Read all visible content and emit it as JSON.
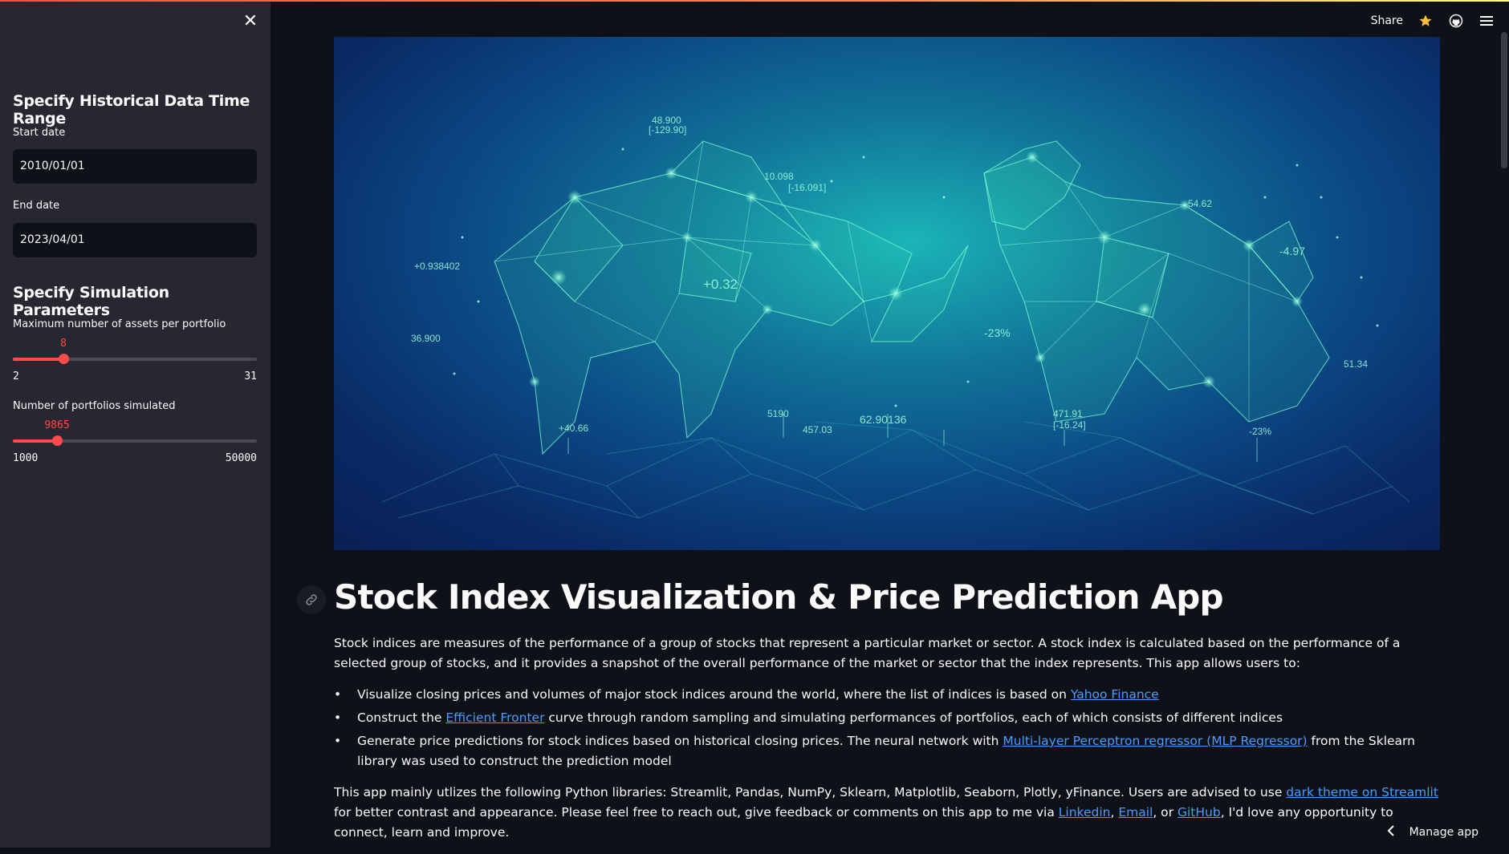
{
  "sidebar": {
    "close_icon": "close-icon",
    "section1_title": "Specify Historical Data Time Range",
    "start_date_label": "Start date",
    "start_date_value": "2010/01/01",
    "end_date_label": "End date",
    "end_date_value": "2023/04/01",
    "section2_title": "Specify Simulation Parameters",
    "slider1": {
      "label": "Maximum number of assets per portfolio",
      "value": "8",
      "min": "2",
      "max": "31"
    },
    "slider2": {
      "label": "Number of portfolios simulated",
      "value": "9865",
      "min": "1000",
      "max": "50000"
    }
  },
  "header": {
    "share_label": "Share",
    "icons": [
      "star-icon",
      "github-icon",
      "hamburger-menu-icon"
    ]
  },
  "hero": {
    "numbers": [
      "48.900",
      "[-129.90]",
      "10.098",
      "[-16.091]",
      "+0.938402",
      "+0.32",
      "36.900",
      "+40.66",
      "5190",
      "457.03",
      "62.90136",
      "-23%",
      "-54.62",
      "-4.97",
      "-23%",
      "471.91",
      "[-16.24]",
      "51.34"
    ]
  },
  "main": {
    "title": "Stock Index Visualization & Price Prediction App",
    "intro": "Stock indices are measures of the performance of a group of stocks that represent a particular market or sector. A stock index is calculated based on the performance of a selected group of stocks, and it provides a snapshot of the overall performance of the market or sector that the index represents. This app allows users to:",
    "bullets": [
      {
        "before": "Visualize closing prices and volumes of major stock indices around the world, where the list of indices is based on ",
        "link": "Yahoo Finance",
        "after": ""
      },
      {
        "before": "Construct the ",
        "link": "Efficient Fronter",
        "after": " curve through random sampling and simulating performances of portfolios, each of which consists of different indices"
      },
      {
        "before": "Generate price predictions for stock indices based on historical closing prices. The neural network with ",
        "link": "Multi-layer Perceptron regressor (MLP Regressor)",
        "after": " from the Sklearn library was used to construct the prediction model"
      }
    ],
    "outro": {
      "part1": "This app mainly utlizes the following Python libraries: Streamlit, Pandas, NumPy, Sklearn, Matplotlib, Seaborn, Plotly, yFinance. Users are advised to use ",
      "link1": "dark theme on Streamlit",
      "part2": " for better contrast and appearance. Please feel free to reach out, give feedback or comments on this app to me via ",
      "link2": "Linkedin",
      "sep1": ", ",
      "link3": "Email",
      "sep2": ", or ",
      "link4": "GitHub",
      "part3": ", I'd love any opportunity to connect, learn and improve."
    }
  },
  "footer": {
    "manage_app_label": "Manage app"
  },
  "colors": {
    "accent": "#ff4b4b",
    "link": "#4a9dff",
    "sidebar_bg": "#262730",
    "main_bg": "#0e1117"
  }
}
